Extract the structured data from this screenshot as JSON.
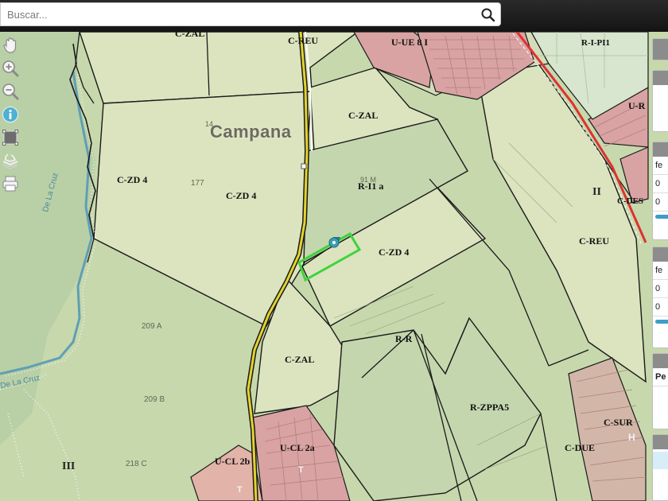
{
  "search": {
    "placeholder": "Buscar..."
  },
  "toolbar": {
    "tools": [
      {
        "name": "pan-hand-icon"
      },
      {
        "name": "zoom-in-icon"
      },
      {
        "name": "zoom-out-icon"
      },
      {
        "name": "info-icon"
      },
      {
        "name": "measure-area-icon"
      },
      {
        "name": "layers-icon"
      },
      {
        "name": "print-icon"
      }
    ]
  },
  "map": {
    "place_name": "Campana",
    "roman_numerals": [
      "II",
      "III"
    ],
    "zones": {
      "c_zal_top": "C-ZAL",
      "c_reu_top": "C-REU",
      "u_ue": "U-UE 8 I",
      "r_i_pi1": "R-I-PI1",
      "u_r": "U-R",
      "c_zal_mid": "C-ZAL",
      "c_zd4_left": "C-ZD 4",
      "c_zd4_center": "C-ZD 4",
      "r_i1a": "R-I1 a",
      "c_zd4_parcel": "C-ZD 4",
      "c_reu_right": "C-REU",
      "c_des": "C-DES",
      "r_r": "R-R",
      "c_zal_low": "C-ZAL",
      "r_zppa5": "R-ZPPA5",
      "c_sur": "C-SUR",
      "c_due": "C-DUE",
      "u_cl2a": "U-CL 2a",
      "u_cl2b": "U-CL 2b"
    },
    "parcel_numbers": [
      "177",
      "209 A",
      "209 B",
      "218 C",
      "91 M",
      "14"
    ],
    "road_labels": {
      "a1": "De La Cruz",
      "a2": "De La Cruz"
    },
    "symbols": {
      "h": "H",
      "t1": "T",
      "t2": "T"
    },
    "colors": {
      "base": "#c7d8ad",
      "zone_fill": "#dbe4bf",
      "zone_dark": "#c4d6ad",
      "urban": "#d9a3a3",
      "selection": "#3cd33c",
      "road": "#e3d32e",
      "river": "#5f9fb4",
      "rail": "#e03030"
    }
  },
  "right_panel": {
    "texts": [
      "fe",
      "0",
      "0",
      "fe",
      "0",
      "0",
      "Pe"
    ]
  }
}
